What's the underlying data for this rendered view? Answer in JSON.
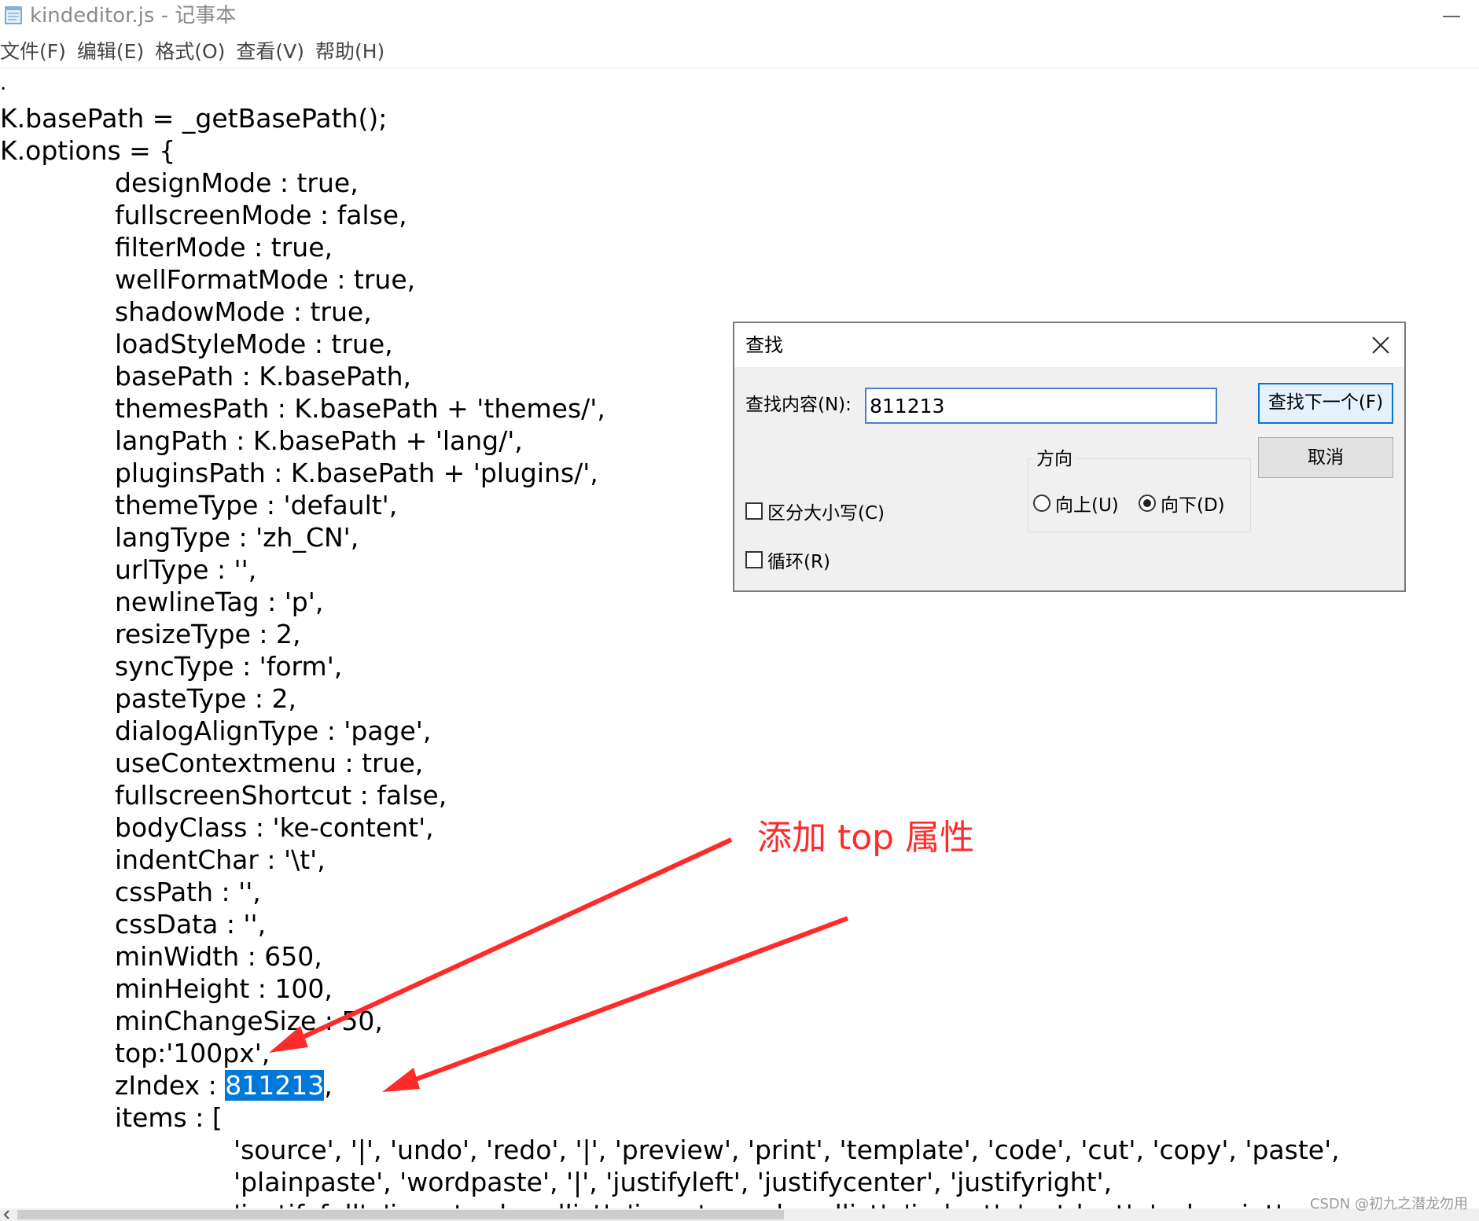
{
  "window": {
    "title": "kindeditor.js - 记事本",
    "icon": "notepad-icon"
  },
  "menu": [
    "文件(F)",
    "编辑(E)",
    "格式(O)",
    "查看(V)",
    "帮助(H)"
  ],
  "editor": {
    "lines": [
      "K.basePath = _getBasePath();",
      "K.options = {",
      "designMode : true,",
      "fullscreenMode : false,",
      "filterMode : true,",
      "wellFormatMode : true,",
      "shadowMode : true,",
      "loadStyleMode : true,",
      "basePath : K.basePath,",
      "themesPath : K.basePath + 'themes/',",
      "langPath : K.basePath + 'lang/',",
      "pluginsPath : K.basePath + 'plugins/',",
      "themeType : 'default',",
      "langType : 'zh_CN',",
      "urlType : '',",
      "newlineTag : 'p',",
      "resizeType : 2,",
      "syncType : 'form',",
      "pasteType : 2,",
      "dialogAlignType : 'page',",
      "useContextmenu : true,",
      "fullscreenShortcut : false,",
      "bodyClass : 'ke-content',",
      "indentChar : '\\t',",
      "cssPath : '',",
      "cssData : '',",
      "minWidth : 650,",
      "minHeight : 100,",
      "minChangeSize : 50,",
      "top:'100px',",
      "items : [",
      "'source', '|', 'undo', 'redo', '|', 'preview', 'print', 'template', 'code', 'cut', 'copy', 'paste',",
      "'plainpaste', 'wordpaste', '|', 'justifyleft', 'justifycenter', 'justifyright',",
      "'justifyfull', 'insertorderedlist', 'insertunorderedlist', 'indent', 'outdent', 'subscript',"
    ],
    "zindex_line": {
      "prefix": "zIndex : ",
      "selected": "811213",
      "suffix": ","
    }
  },
  "find_dialog": {
    "title": "查找",
    "find_label": "查找内容(N):",
    "find_value": "811213",
    "find_next_label": "查找下一个(F)",
    "cancel_label": "取消",
    "direction_label": "方向",
    "up_label": "向上(U)",
    "down_label": "向下(D)",
    "direction_selected": "down",
    "match_case_label": "区分大小写(C)",
    "match_case_checked": false,
    "wrap_label": "循环(R)",
    "wrap_checked": false
  },
  "annotation": {
    "text": "添加 top 属性",
    "color": "#ff2a2a"
  },
  "watermark": "CSDN @初九之潜龙勿用",
  "colors": {
    "selection": "#0078d7",
    "dialog_bg": "#f0f0f0",
    "default_button_border": "#0078d7"
  }
}
